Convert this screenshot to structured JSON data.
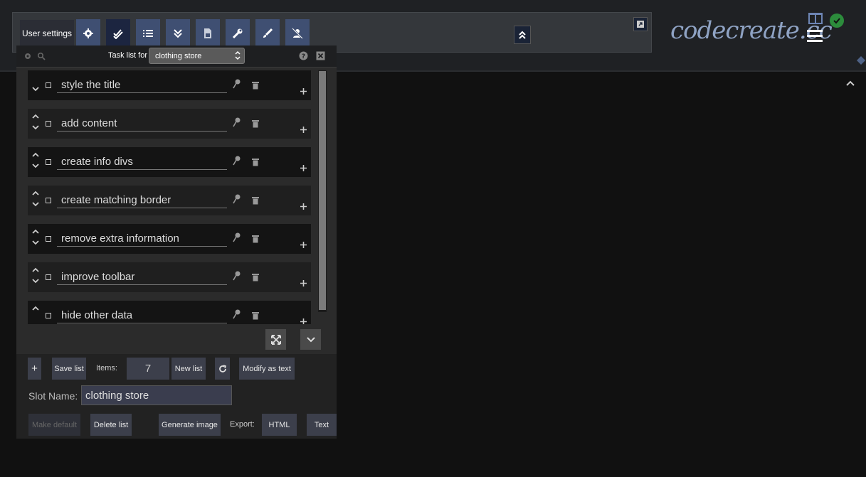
{
  "toolbar": {
    "user_settings_label": "User settings",
    "buttons": [
      {
        "icon": "gear-icon"
      },
      {
        "icon": "double-check-icon",
        "active": true
      },
      {
        "icon": "numbered-list-icon"
      },
      {
        "icon": "double-chevron-down-icon"
      },
      {
        "icon": "js-file-icon"
      },
      {
        "icon": "wrench-icon"
      },
      {
        "icon": "brush-icon"
      },
      {
        "icon": "user-slash-icon"
      }
    ]
  },
  "logo": {
    "text": "codecreate.cc"
  },
  "panel": {
    "header_label": "Task list for",
    "selected_list": "clothing store",
    "tasks": [
      {
        "text": "style the title"
      },
      {
        "text": "add content"
      },
      {
        "text": "create info divs"
      },
      {
        "text": "create matching border"
      },
      {
        "text": "remove extra information"
      },
      {
        "text": "improve toolbar"
      },
      {
        "text": "hide other data"
      }
    ]
  },
  "bottom": {
    "add_label": "+",
    "save_label": "Save list",
    "items_label": "Items:",
    "items_count": "7",
    "new_list_label": "New list",
    "modify_label": "Modify as text",
    "slot_name_label": "Slot Name:",
    "slot_name_value": "clothing store",
    "make_default_label": "Make default",
    "delete_label": "Delete list",
    "generate_label": "Generate image",
    "export_label": "Export:",
    "export_html_label": "HTML",
    "export_text_label": "Text"
  }
}
